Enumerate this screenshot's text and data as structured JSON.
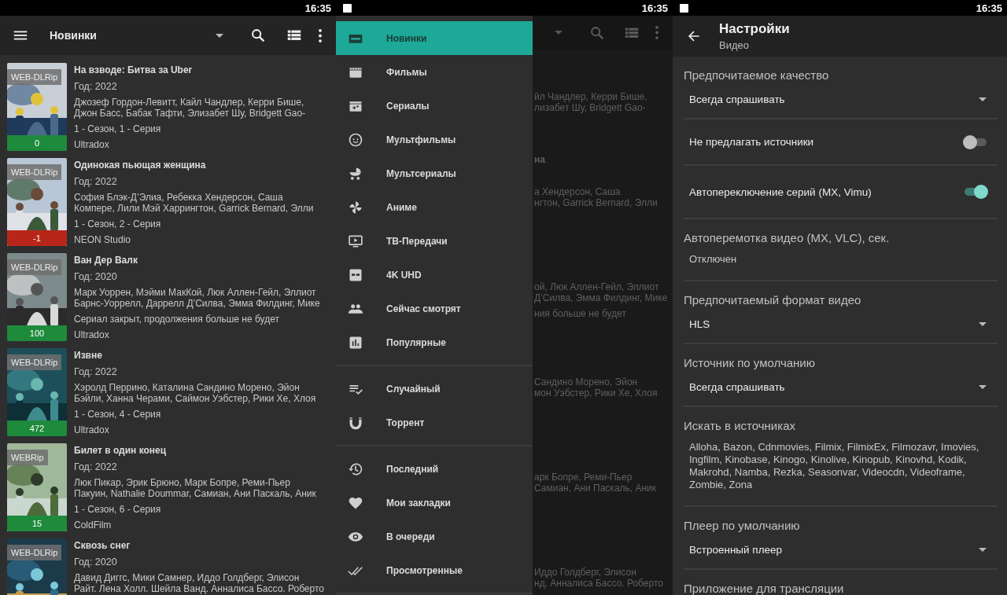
{
  "list_screen": {
    "status_bar": {
      "time": "16:35",
      "notification": false
    },
    "toolbar": {
      "title": "Новинки"
    },
    "items": [
      {
        "quality": "WEB-DLRip",
        "score": "0",
        "color": "#1e8a3c",
        "title": "На взводе: Битва за Uber",
        "year": "Год: 2022",
        "cast": [
          "Джозеф Гордон-Левитт, Кайл Чандлер, Керри Бише,",
          "Джон Басс, Бабак Тафти, Элизабет Шу, Bridgett Gao-"
        ],
        "episode": "1 - Сезон, 1 - Серия",
        "studio": "Ultradox"
      },
      {
        "quality": "WEB-DLRip",
        "score": "-1",
        "color": "#b8261a",
        "title": "Одинокая пьющая женщина",
        "year": "Год: 2022",
        "cast": [
          "София Блэк-Д’Элиа, Ребекка Хендерсон, Саша",
          "Компере, Лили Мэй Харрингтон, Garrick Bernard, Элли"
        ],
        "episode": "1 - Сезон, 2 - Серия",
        "studio": "NEON Studio"
      },
      {
        "quality": "WEB-DLRip",
        "score": "100",
        "color": "#1e8a3c",
        "title": "Ван Дер Валк",
        "year": "Год: 2020",
        "cast": [
          "Марк Уоррен, Мэйми МакКой, Люк Аллен-Гейл, Эллиот",
          "Барнс-Уоррелл, Даррелл Д’Силва, Эмма Филдинг, Мике"
        ],
        "episode": "Сериал закрыт, продолжения больше не будет",
        "studio": "Ultradox"
      },
      {
        "quality": "WEB-DLRip",
        "score": "472",
        "color": "#1e8a3c",
        "title": "Извне",
        "year": "Год: 2022",
        "cast": [
          "Хэролд Перрино, Каталина Сандино Морено, Эйон",
          "Бэйли, Ханна Черами, Саймон Уэбстер, Рики Хе, Хлоя"
        ],
        "episode": "1 - Сезон, 4 - Серия",
        "studio": "Ultradox"
      },
      {
        "quality": "WEBRip",
        "score": "15",
        "color": "#1e8a3c",
        "title": "Билет в один конец",
        "year": "Год: 2022",
        "cast": [
          "Люк Пикар, Эрик Брюно, Марк Бопре, Реми-Пьер",
          "Пакуин, Nathalie Doummar, Самиан, Ани Паскаль, Аник"
        ],
        "episode": "1 - Сезон, 6 - Серия",
        "studio": "ColdFilm"
      },
      {
        "quality": "WEB-DLRip",
        "title": "Сквозь снег",
        "year": "Год: 2020",
        "cast": [
          "Давид Диггс, Мики Самнер, Иддо Голдберг, Элисон",
          "Райт. Лена Холл. Шейла Ванд. Анналиса Бассо. Роберто"
        ]
      }
    ]
  },
  "drawer_screen": {
    "status_bar": {
      "time": "16:35",
      "notification": true
    },
    "drawer": {
      "groups": [
        [
          {
            "label": "Новинки",
            "selected": true
          },
          {
            "label": "Фильмы",
            "selected": false
          },
          {
            "label": "Сериалы",
            "selected": false
          },
          {
            "label": "Мультфильмы",
            "selected": false
          },
          {
            "label": "Мультсериалы",
            "selected": false
          },
          {
            "label": "Аниме",
            "selected": false
          },
          {
            "label": "ТВ-Передачи",
            "selected": false
          },
          {
            "label": "4K UHD",
            "selected": false
          },
          {
            "label": "Сейчас смотрят",
            "selected": false
          },
          {
            "label": "Популярные",
            "selected": false
          }
        ],
        [
          {
            "label": "Случайный",
            "selected": false
          },
          {
            "label": "Торрент",
            "selected": false
          }
        ],
        [
          {
            "label": "Последний",
            "selected": false
          },
          {
            "label": "Мои закладки",
            "selected": false
          },
          {
            "label": "В очереди",
            "selected": false
          },
          {
            "label": "Просмотренные",
            "selected": false
          }
        ]
      ]
    },
    "backdrop": {
      "items": [
        {
          "cast": [
            "йл Чандлер, Керри Бише,",
            "лизабет Шу, Bridgett Gao-"
          ]
        },
        {
          "title": "на",
          "cast": [
            "а Хендерсон, Саша",
            "нгтон, Garrick Bernard, Элли"
          ]
        },
        {
          "cast": [
            "ой, Люк Аллен-Гейл, Эллиот",
            "Д’Силва, Эмма Филдинг, Мике"
          ],
          "episode": "ния больше не будет"
        },
        {
          "cast": [
            "Сандино Морено, Эйон",
            "мон Уэбстер, Рики Хе, Хлоя"
          ]
        },
        {
          "cast": [
            "арк Бопре, Реми-Пьер",
            "Самиан, Ани Паскаль, Аник"
          ]
        },
        {
          "cast": [
            "Иддо Голдберг, Элисон",
            "нд. Анналиса Бассо. Роберто"
          ]
        }
      ]
    }
  },
  "settings_screen": {
    "status_bar": {
      "time": "16:35",
      "notification": true
    },
    "toolbar": {
      "title": "Настройки",
      "subtitle": "Видео"
    },
    "preferences": [
      {
        "kind": "dropdown",
        "title": "Предпочитаемое качество",
        "value": "Всегда спрашивать"
      },
      {
        "kind": "switch",
        "title": "Не предлагать источники",
        "on": false
      },
      {
        "kind": "switch",
        "title": "Автопереключение серий (MX, Vimu)",
        "on": true
      },
      {
        "kind": "text",
        "title": "Автоперемотка видео (MX, VLC), сек.",
        "summary": "Отключен"
      },
      {
        "kind": "dropdown",
        "title": "Предпочитаемый формат видео",
        "value": "HLS"
      },
      {
        "kind": "dropdown",
        "title": "Источник по умолчанию",
        "value": "Всегда спрашивать"
      },
      {
        "kind": "text",
        "title": "Искать в источниках",
        "summary": "Alloha, Bazon, Cdnmovies, Filmix, FilmixEx, Filmozavr, Imovies, Ingfilm, Kinobase, Kinogo, Kinolive, Kinopub, Kinovhd, Kodik, Makrohd, Namba, Rezka, Seasonvar, Videocdn, Videoframe, Zombie, Zona"
      },
      {
        "kind": "dropdown",
        "title": "Плеер по умолчанию",
        "value": "Встроенный плеер"
      },
      {
        "kind": "text",
        "title": "Приложение для трансляции"
      }
    ]
  }
}
